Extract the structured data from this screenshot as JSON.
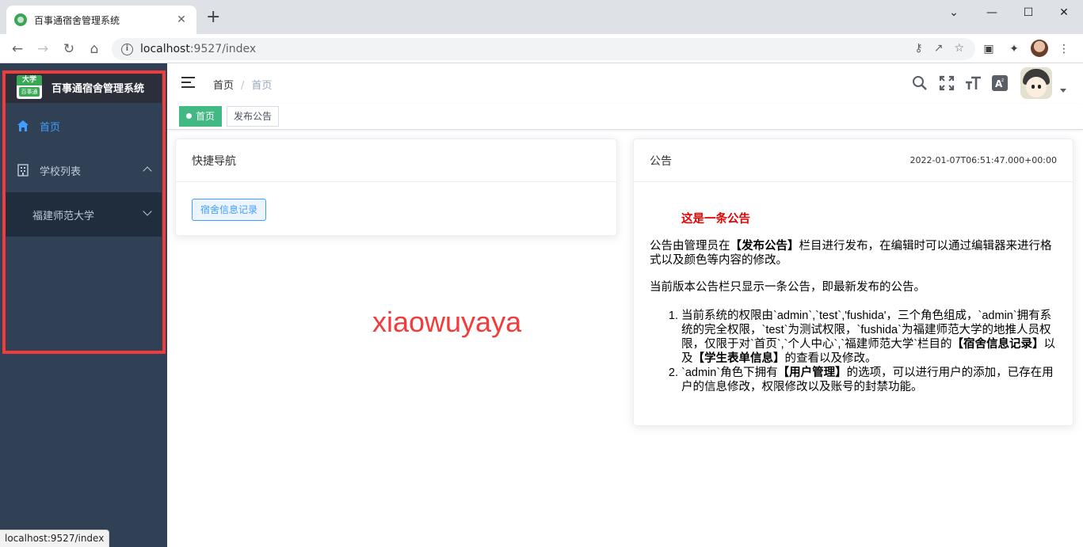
{
  "browser": {
    "tab_title": "百事通宿舍管理系统",
    "tab_close": "✕",
    "new_tab": "+",
    "url_host": "localhost",
    "url_path": ":9527/index",
    "status_url": "localhost:9527/index",
    "window_controls": [
      "⌄",
      "—",
      "☐",
      "✕"
    ]
  },
  "sidebar": {
    "logo_top": "大学",
    "logo_bottom": "百事通",
    "title": "百事通宿舍管理系统",
    "items": [
      {
        "label": "首页",
        "icon": "home-icon",
        "active": true
      },
      {
        "label": "学校列表",
        "icon": "building-icon",
        "expanded": true
      },
      {
        "label": "福建师范大学",
        "expanded": false
      }
    ]
  },
  "navbar": {
    "breadcrumb": [
      "首页",
      "首页"
    ],
    "breadcrumb_sep": "/",
    "icons": [
      "search-icon",
      "fullscreen-icon",
      "font-size-icon",
      "translate-icon"
    ]
  },
  "tags": [
    {
      "label": "首页",
      "active": true
    },
    {
      "label": "发布公告",
      "active": false
    }
  ],
  "quick_nav": {
    "title": "快捷导航",
    "button": "宿舍信息记录"
  },
  "notice": {
    "title": "公告",
    "date": "2022-01-07T06:51:47.000+00:00",
    "heading": "这是一条公告",
    "p1_a": "公告由管理员在",
    "p1_b": "【发布公告】",
    "p1_c": "栏目进行发布，在编辑时可以通过编辑器来进行格式以及颜色等内容的修改。",
    "p2": "当前版本公告栏只显示一条公告，即最新发布的公告。",
    "li1_a": "当前系统的权限由`admin`,`test`,'fushida'，三个角色组成，`admin`拥有系统的完全权限，`test`为测试权限，`fushida`为福建师范大学的地推人员权限，仅限于对`首页`,`个人中心`,`福建师范大学`栏目的",
    "li1_b": "【宿舍信息记录】",
    "li1_c": "以及",
    "li1_d": "【学生表单信息】",
    "li1_e": "的查看以及修改。",
    "li2_a": "`admin`角色下拥有",
    "li2_b": "【用户管理】",
    "li2_c": "的选项，可以进行用户的添加，已存在用户的信息修改，权限修改以及账号的封禁功能。"
  },
  "watermark": "xiaowuyaya",
  "colors": {
    "sidebar_bg": "#304156",
    "accent": "#409eff",
    "tag_active": "#42b983",
    "notice_red": "#e60000",
    "highlight_border": "#f23c3c"
  }
}
